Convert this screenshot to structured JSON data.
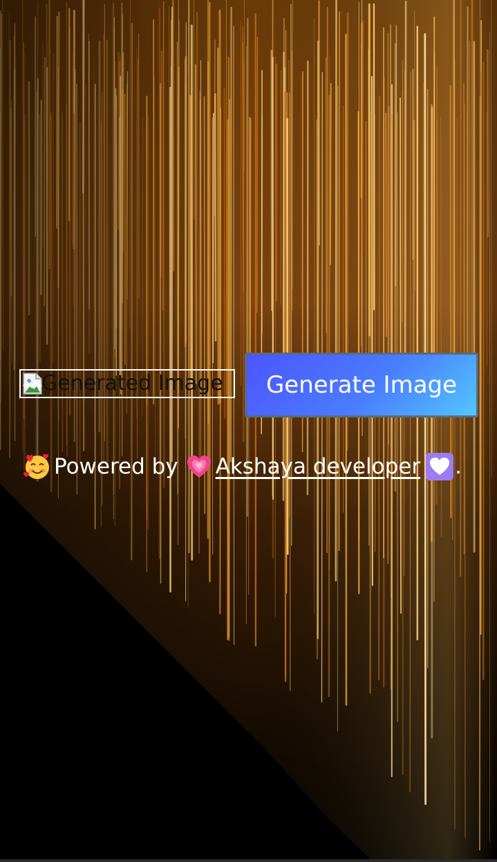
{
  "background": {
    "image": "golden-light-streaks-background",
    "colors": {
      "gold": "#d8902a",
      "amber": "#a85a10",
      "dark": "#000000"
    }
  },
  "generated_image": {
    "alt": "Generated Image",
    "icon": "broken-image-icon"
  },
  "generate_button": {
    "label": "Generate Image",
    "gradient": [
      "#4d55ff",
      "#52c6ff"
    ]
  },
  "credit": {
    "leading_emoji": "smiling-face-with-hearts-icon",
    "prefix": "Powered by",
    "link_emoji": "growing-heart-icon",
    "link_text": " Akshaya developer ",
    "trailing_emoji": "white-heart-icon",
    "suffix": "."
  }
}
